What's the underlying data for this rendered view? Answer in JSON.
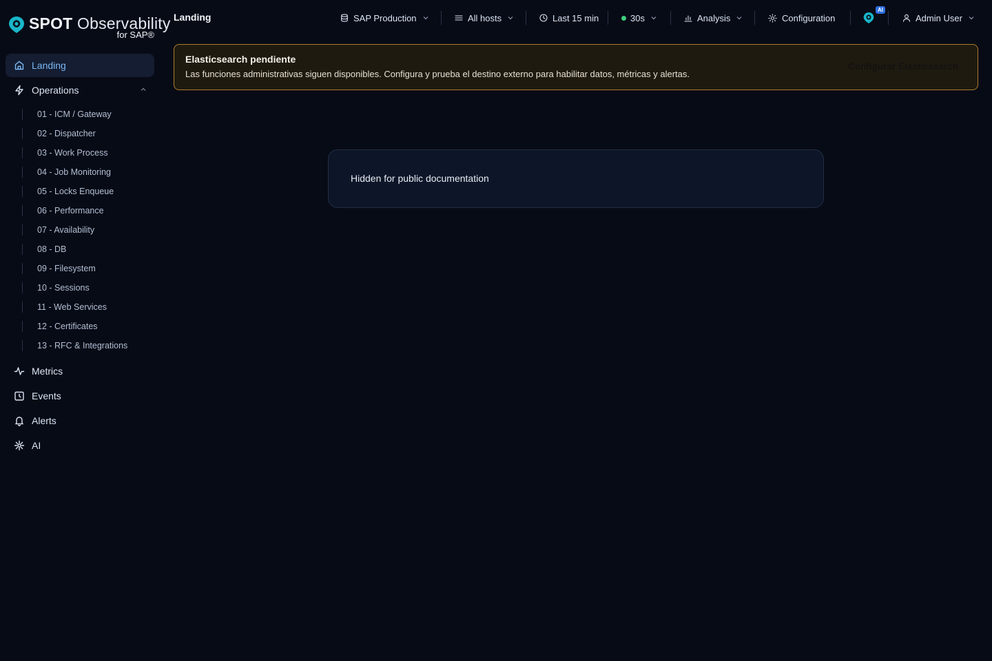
{
  "app": {
    "logo_bold": "SPOT",
    "logo_light": "Observability",
    "logo_sub": "for SAP®",
    "brand_color": "#19b5c8"
  },
  "sidebar": {
    "items": [
      {
        "label": "Landing",
        "icon": "home-icon",
        "active": true
      },
      {
        "label": "Operations",
        "icon": "bolt-icon",
        "expanded": true
      }
    ],
    "operations_children": [
      "01 - ICM / Gateway",
      "02 - Dispatcher",
      "03 - Work Process",
      "04 - Job Monitoring",
      "05 - Locks Enqueue",
      "06 - Performance",
      "07 - Availability",
      "08 - DB",
      "09 - Filesystem",
      "10 - Sessions",
      "11 - Web Services",
      "12 - Certificates",
      "13 - RFC & Integrations"
    ],
    "lower_items": [
      {
        "label": "Metrics",
        "icon": "activity-icon"
      },
      {
        "label": "Events",
        "icon": "calendar-clock-icon"
      },
      {
        "label": "Alerts",
        "icon": "bell-icon"
      },
      {
        "label": "AI",
        "icon": "sparkle-icon"
      }
    ]
  },
  "header": {
    "title": "Landing",
    "system": "SAP Production",
    "hosts": "All hosts",
    "time_range": "Last 15 min",
    "refresh": "30s",
    "refresh_status_color": "#3fcf7e",
    "analysis": "Analysis",
    "configuration": "Configuration",
    "ai_badge": "AI",
    "user": "Admin User"
  },
  "banner": {
    "title": "Elasticsearch pendiente",
    "text": "Las funciones administrativas siguen disponibles. Configura y prueba el destino externo para habilitar datos, métricas y alertas.",
    "action": "Configurar Elasticsearch",
    "border_color": "#a97e2a"
  },
  "main": {
    "card_text": "Hidden for public documentation"
  }
}
